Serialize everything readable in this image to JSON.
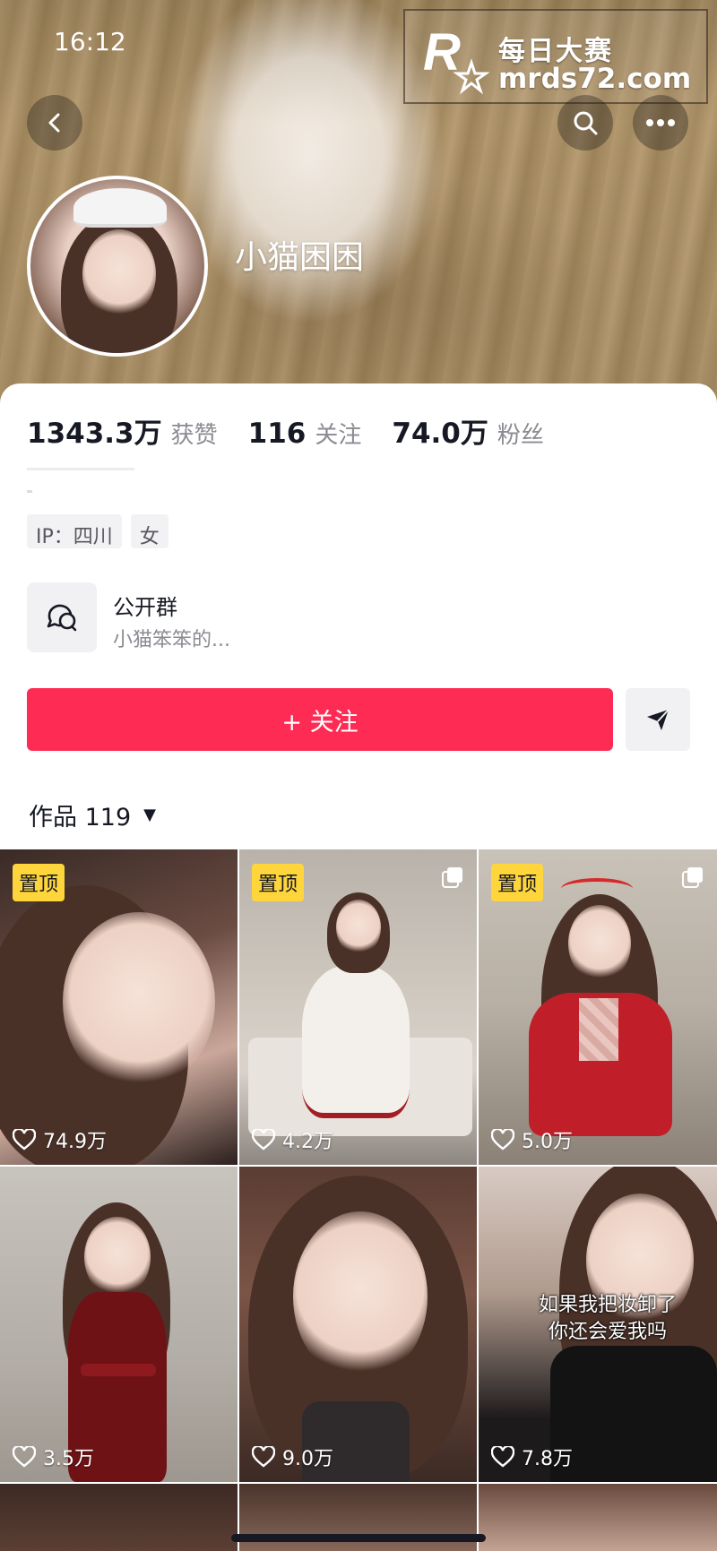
{
  "status_bar": {
    "time": "16:12"
  },
  "watermark": {
    "title": "每日大赛",
    "url": "mrds72.com",
    "logo_text": "每日大赛"
  },
  "profile": {
    "nickname": "小猫困困",
    "stats": [
      {
        "value": "1343.3万",
        "label": "获赞"
      },
      {
        "value": "116",
        "label": "关注"
      },
      {
        "value": "74.0万",
        "label": "粉丝"
      }
    ],
    "tags": [
      "IP：四川",
      "女"
    ],
    "group": {
      "title": "公开群",
      "description": "小猫笨笨的..."
    },
    "follow_label": "+ 关注",
    "works_label": "作品 119"
  },
  "grid": {
    "tiles": [
      {
        "pinned": "置顶",
        "likes": "74.9万",
        "multi": false,
        "caption": ""
      },
      {
        "pinned": "置顶",
        "likes": "4.2万",
        "multi": true,
        "caption": ""
      },
      {
        "pinned": "置顶",
        "likes": "5.0万",
        "multi": true,
        "caption": ""
      },
      {
        "pinned": "",
        "likes": "3.5万",
        "multi": false,
        "caption": ""
      },
      {
        "pinned": "",
        "likes": "9.0万",
        "multi": false,
        "caption": ""
      },
      {
        "pinned": "",
        "likes": "7.8万",
        "multi": false,
        "caption": "如果我把妆卸了你还会爱我吗"
      }
    ]
  },
  "colors": {
    "accent": "#fe2c55",
    "pin_bg": "#fed63c",
    "text": "#161823",
    "muted": "#8a8b91"
  }
}
